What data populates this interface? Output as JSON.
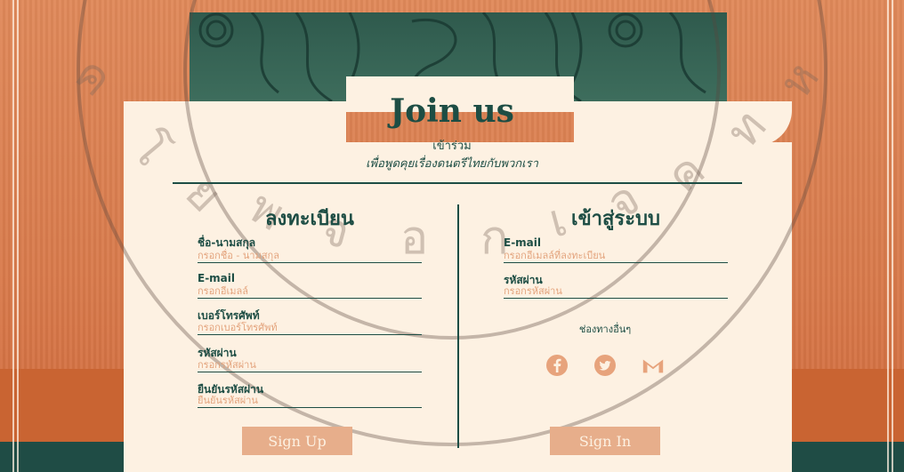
{
  "header": {
    "title": "Join us",
    "subtitle": "เข้าร่วม",
    "tagline": "เพื่อพูดคุยเรื่องดนตรีไทยกับพวกเรา"
  },
  "register": {
    "title": "ลงทะเบียน",
    "fields": [
      {
        "label": "ชื่อ-นามสกุล",
        "placeholder": "กรอกชื่อ - นามสกุล"
      },
      {
        "label": "E-mail",
        "placeholder": "กรอกอีเมลล์"
      },
      {
        "label": "เบอร์โทรศัพท์",
        "placeholder": "กรอกเบอร์โทรศัพท์"
      },
      {
        "label": "รหัสผ่าน",
        "placeholder": "กรอกรหัสผ่าน"
      },
      {
        "label": "ยืนยันรหัสผ่าน",
        "placeholder": "ยืนยันรหัสผ่าน"
      }
    ],
    "button_label": "Sign Up"
  },
  "login": {
    "title": "เข้าสู่ระบบ",
    "fields": [
      {
        "label": "E-mail",
        "placeholder": "กรอกอีเมลล์ที่ลงทะเบียน"
      },
      {
        "label": "รหัสผ่าน",
        "placeholder": "กรอกรหัสผ่าน"
      }
    ],
    "other_label": "ช่องทางอื่นๆ",
    "socials": [
      {
        "icon": "facebook-icon"
      },
      {
        "icon": "twitter-icon"
      },
      {
        "icon": "gmail-icon"
      }
    ],
    "button_label": "Sign In"
  },
  "watermark": {
    "text": "เทคโนโลยีพระจอมเกล้าเจ้าคุณทหาร"
  },
  "colors": {
    "dark_green": "#1d4d44",
    "accent_orange": "#d9794a",
    "cream": "#fdf1e2",
    "button": "#e7ae8b",
    "placeholder": "#e3a37c"
  }
}
